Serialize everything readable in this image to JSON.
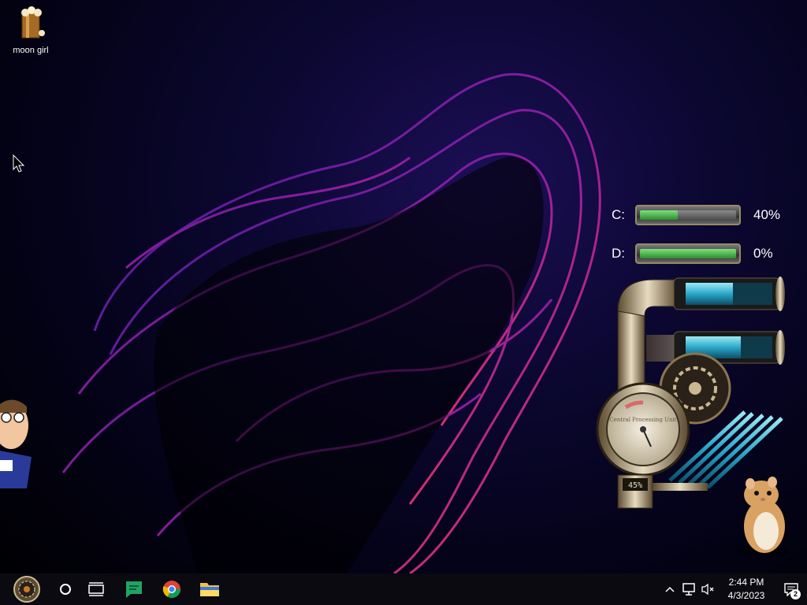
{
  "desktop": {
    "icons": [
      {
        "label": "moon girl",
        "icon": "popcorn-bucket-icon"
      }
    ]
  },
  "drive_meters": [
    {
      "letter": "C:",
      "percent_text": "40%",
      "percent": 40
    },
    {
      "letter": "D:",
      "percent_text": "0%",
      "percent": 0
    }
  ],
  "steampunk_widget": {
    "gauge_readout": "45%",
    "gauge_face_text": "Central Processing Unit"
  },
  "taskbar": {
    "start_icon": "steampunk-start-orb-icon",
    "buttons": [
      {
        "name": "cortana-button",
        "icon": "circle-icon"
      },
      {
        "name": "task-view-button",
        "icon": "task-view-icon"
      },
      {
        "name": "google-chat-button",
        "icon": "chat-icon"
      },
      {
        "name": "chrome-button",
        "icon": "chrome-icon"
      },
      {
        "name": "file-explorer-button",
        "icon": "folder-icon"
      }
    ]
  },
  "system_tray": {
    "time": "2:44 PM",
    "date": "4/3/2023",
    "notification_count": "2"
  },
  "colors": {
    "taskbar_bg": "#0a0a10",
    "drive_fill": "#4fbf4f",
    "tube_blue": "#3ec6e0"
  }
}
